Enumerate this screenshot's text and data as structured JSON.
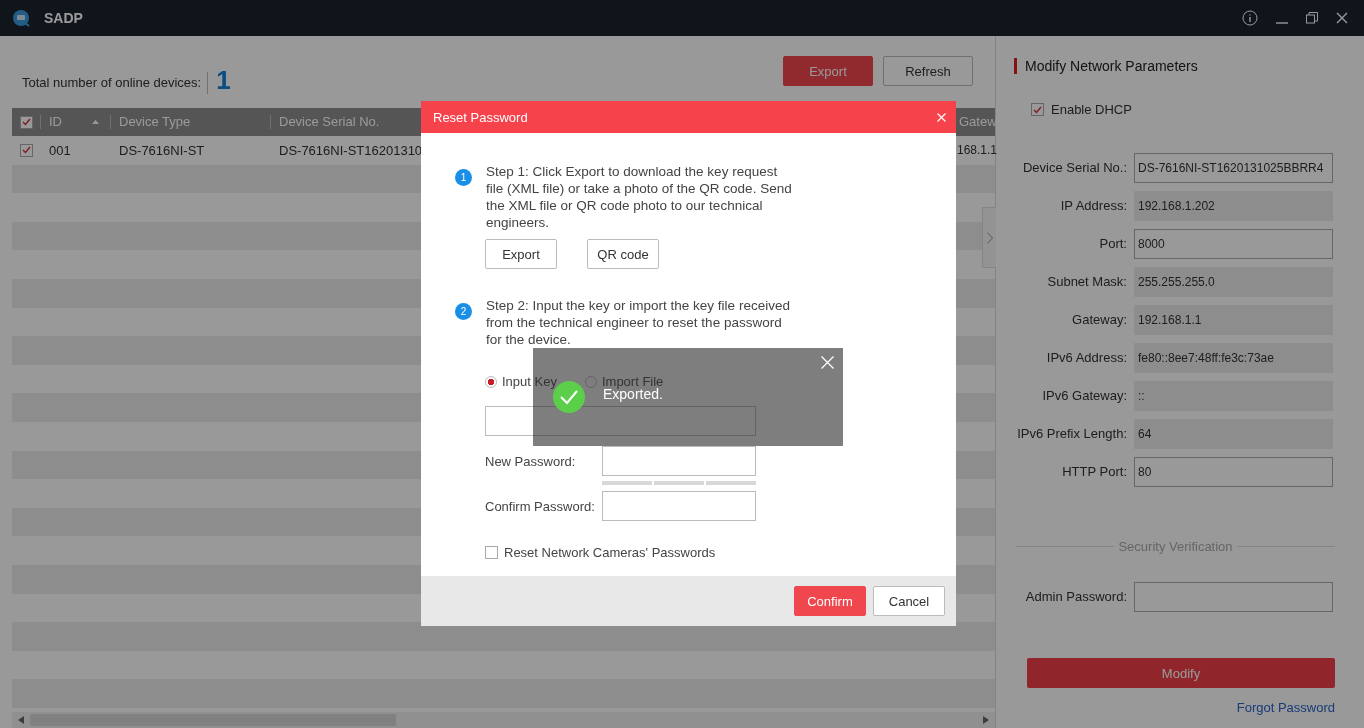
{
  "app": {
    "title": "SADP"
  },
  "device_list": {
    "count_label": "Total number of online devices:",
    "count": "1",
    "buttons": [
      {
        "label": "Export",
        "kind": "primary"
      },
      {
        "label": "Refresh",
        "kind": "default"
      }
    ],
    "select_all_checked": true,
    "columns": [
      "ID",
      "Device Type",
      "Device Serial No.",
      "Gatew"
    ],
    "rows": [
      {
        "checked": true,
        "cells": [
          "001",
          "DS-7616NI-ST",
          "DS-7616NI-ST16201310",
          "168.1.1"
        ]
      }
    ]
  },
  "network_panel": {
    "title": "Modify Network Parameters",
    "dhcp": {
      "label": "Enable DHCP",
      "checked": true
    },
    "fields": [
      {
        "label": "Device Serial No.:",
        "value": "DS-7616NI-ST1620131025BBRR4",
        "disabled": false
      },
      {
        "label": "IP Address:",
        "value": "192.168.1.202",
        "disabled": true
      },
      {
        "label": "Port:",
        "value": "8000",
        "disabled": false
      },
      {
        "label": "Subnet Mask:",
        "value": "255.255.255.0",
        "disabled": true
      },
      {
        "label": "Gateway:",
        "value": "192.168.1.1",
        "disabled": true
      },
      {
        "label": "IPv6 Address:",
        "value": "fe80::8ee7:48ff:fe3c:73ae",
        "disabled": true
      },
      {
        "label": "IPv6 Gateway:",
        "value": "::",
        "disabled": true
      },
      {
        "label": "IPv6 Prefix Length:",
        "value": "64",
        "disabled": true
      },
      {
        "label": "HTTP Port:",
        "value": "80",
        "disabled": false
      }
    ],
    "section_title": "Security Verification",
    "admin_password_label": "Admin Password:",
    "modify_button": "Modify",
    "forgot_link": "Forgot Password"
  },
  "dialog": {
    "title": "Reset Password",
    "steps": [
      {
        "number": "1",
        "text": "Step 1: Click Export to download the key request file (XML file) or take a photo of the QR code. Send the XML file or QR code photo to our technical engineers."
      },
      {
        "number": "2",
        "text": "Step 2: Input the key or import the key file received from the technical engineer to reset the password for the device."
      }
    ],
    "step1_buttons": [
      "Export",
      "QR code"
    ],
    "modes": [
      {
        "label": "Input Key",
        "selected": true
      },
      {
        "label": "Import File",
        "selected": false
      }
    ],
    "new_password_label": "New Password:",
    "confirm_password_label": "Confirm Password:",
    "reset_cameras": {
      "label": "Reset Network Cameras' Passwords",
      "checked": false
    },
    "buttons": [
      {
        "label": "Confirm",
        "kind": "primary"
      },
      {
        "label": "Cancel",
        "kind": "default"
      }
    ]
  },
  "toast": {
    "message": "Exported."
  }
}
